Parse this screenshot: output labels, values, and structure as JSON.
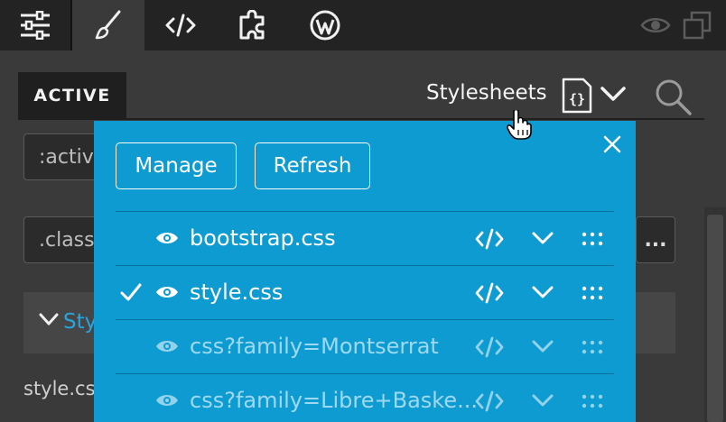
{
  "toolbar": {
    "items": [
      {
        "icon": "sliders-icon",
        "active": false
      },
      {
        "icon": "brush-icon",
        "active": true
      },
      {
        "icon": "code-icon",
        "active": false
      },
      {
        "icon": "puzzle-icon",
        "active": false
      },
      {
        "icon": "wordpress-icon",
        "active": false
      }
    ],
    "right_icons": [
      "eye-icon",
      "windows-icon"
    ]
  },
  "panel": {
    "active_tab": "ACTIVE",
    "stylesheets_label": "Stylesheets",
    "state_field_value": ":activ",
    "class_field_placeholder": ".class",
    "ellipsis_label": "...",
    "section_label": "Sty",
    "bottom_label": "style.cs"
  },
  "popover": {
    "manage_label": "Manage",
    "refresh_label": "Refresh",
    "sheets": [
      {
        "name": "bootstrap.css",
        "checked": false,
        "dim": false
      },
      {
        "name": "style.css",
        "checked": true,
        "dim": false
      },
      {
        "name": "css?family=Montserrat",
        "checked": false,
        "dim": true
      },
      {
        "name": "css?family=Libre+Baske...",
        "checked": false,
        "dim": true
      }
    ]
  },
  "colors": {
    "popover_bg": "#0e9bd1",
    "toolbar_bg": "#232323",
    "panel_bg": "#3a3a3a",
    "link_blue": "#29a4de"
  }
}
